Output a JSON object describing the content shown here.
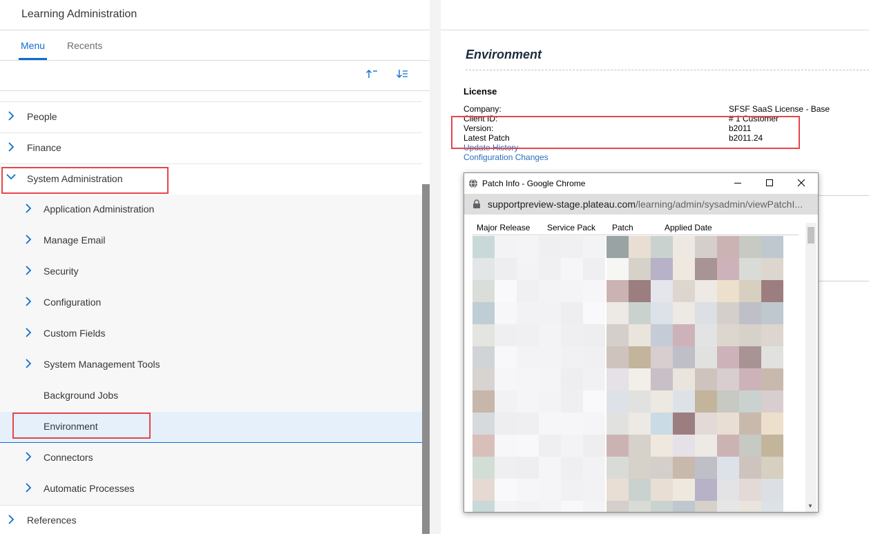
{
  "app": {
    "title": "Learning Administration"
  },
  "tabs": [
    {
      "label": "Menu"
    },
    {
      "label": "Recents"
    }
  ],
  "tools": {
    "sort_up_icon": "sort-ascending-icon",
    "sort_down_icon": "sort-descending-icon"
  },
  "tree": {
    "items": [
      {
        "label": "People",
        "level": 0,
        "state": "collapsed"
      },
      {
        "label": "Finance",
        "level": 0,
        "state": "collapsed"
      },
      {
        "label": "System Administration",
        "level": 0,
        "state": "expanded"
      },
      {
        "label": "Application Administration",
        "level": 1,
        "state": "collapsed"
      },
      {
        "label": "Manage Email",
        "level": 1,
        "state": "collapsed"
      },
      {
        "label": "Security",
        "level": 1,
        "state": "collapsed"
      },
      {
        "label": "Configuration",
        "level": 1,
        "state": "collapsed"
      },
      {
        "label": "Custom Fields",
        "level": 1,
        "state": "collapsed"
      },
      {
        "label": "System Management Tools",
        "level": 1,
        "state": "collapsed"
      },
      {
        "label": "Background Jobs",
        "level": 1,
        "state": "leaf"
      },
      {
        "label": "Environment",
        "level": 1,
        "state": "selected"
      },
      {
        "label": "Connectors",
        "level": 1,
        "state": "collapsed"
      },
      {
        "label": "Automatic Processes",
        "level": 1,
        "state": "collapsed"
      },
      {
        "label": "References",
        "level": 0,
        "state": "collapsed"
      }
    ]
  },
  "environment": {
    "title": "Environment",
    "license_heading": "License",
    "rows": [
      {
        "key": "Company:",
        "value": "SFSF SaaS License - Base"
      },
      {
        "key": "Client ID:",
        "value": "# 1 Customer"
      },
      {
        "key": "Version:",
        "value": "b2011"
      },
      {
        "key": "Latest Patch",
        "value": "b2011.24"
      }
    ],
    "links": [
      "Update History",
      "Configuration Changes"
    ]
  },
  "popup": {
    "title": "Patch Info - Google Chrome",
    "url_host": "supportpreview-stage.plateau.com",
    "url_path": "/learning/admin/sysadmin/viewPatchI...",
    "columns": [
      "Major Release",
      "Service Pack",
      "Patch",
      "Applied Date"
    ]
  },
  "colors": {
    "accent": "#0a6ed1",
    "highlight_box": "#e8434a",
    "link": "#2a6ebb",
    "selected_row": "#e5f0fa"
  }
}
